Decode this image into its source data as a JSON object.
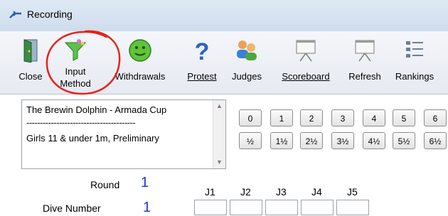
{
  "window": {
    "title": "Recording"
  },
  "toolbar": {
    "items": [
      {
        "label": "Close",
        "icon": "door-icon"
      },
      {
        "label": "Input\nMethod",
        "icon": "funnel-icon"
      },
      {
        "label": "Withdrawals",
        "icon": "smiley-icon"
      },
      {
        "label": "Protest",
        "icon": "question-mark-icon"
      },
      {
        "label": "Judges",
        "icon": "people-icon"
      },
      {
        "label": "Scoreboard",
        "icon": "presentation-board-icon"
      },
      {
        "label": "Refresh",
        "icon": "presentation-board-icon"
      },
      {
        "label": "Rankings",
        "icon": "ranked-list-icon"
      }
    ]
  },
  "event_list": {
    "line1": "The Brewin Dolphin - Armada Cup",
    "separator": "----------------------------------------",
    "line2": "Girls 11 & under 1m, Preliminary"
  },
  "score_keys": {
    "whole": [
      "0",
      "1",
      "2",
      "3",
      "4",
      "5",
      "6"
    ],
    "half": [
      "½",
      "1½",
      "2½",
      "3½",
      "4½",
      "5½",
      "6½"
    ]
  },
  "round": {
    "label": "Round",
    "value": "1"
  },
  "dive": {
    "label": "Dive Number",
    "value": "1"
  },
  "judges": [
    "J1",
    "J2",
    "J3",
    "J4",
    "J5"
  ],
  "colors": {
    "accent_blue": "#1a3bd6",
    "annotation_red": "#e8211c"
  }
}
